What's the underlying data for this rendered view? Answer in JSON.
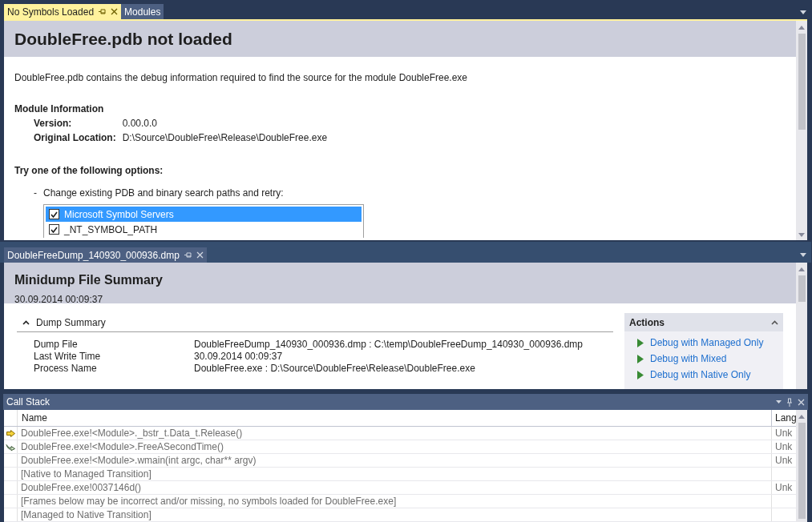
{
  "symbols_pane": {
    "tabs": [
      {
        "label": "No Symbols Loaded",
        "selected": true,
        "pinnable": true
      },
      {
        "label": "Modules",
        "selected": false,
        "pinnable": false
      }
    ],
    "title": "DoubleFree.pdb not loaded",
    "description": "DoubleFree.pdb contains the debug information required to find the source for the module DoubleFree.exe",
    "module_heading": "Module Information",
    "module_info": [
      {
        "label": "Version:",
        "value": "0.00.0.0"
      },
      {
        "label": "Original Location:",
        "value": "D:\\Source\\DoubleFree\\Release\\DoubleFree.exe"
      }
    ],
    "options_heading": "Try one of the following options:",
    "option_bullet": "-",
    "option_text": "Change existing PDB and binary search paths and retry:",
    "search_paths": [
      {
        "label": "Microsoft Symbol Servers",
        "checked": true,
        "selected": true
      },
      {
        "label": "_NT_SYMBOL_PATH",
        "checked": true,
        "selected": false
      }
    ]
  },
  "dump_pane": {
    "tabs": [
      {
        "label": "DoubleFreeDump_140930_000936.dmp",
        "selected": false,
        "pinnable": true
      }
    ],
    "title": "Minidump File Summary",
    "timestamp": "30.09.2014 00:09:37",
    "section": {
      "label": "Dump Summary",
      "expanded": true
    },
    "rows": [
      {
        "label": "Dump File",
        "value": "DoubleFreeDump_140930_000936.dmp : C:\\temp\\DoubleFreeDump_140930_000936.dmp"
      },
      {
        "label": "Last Write Time",
        "value": "30.09.2014 00:09:37"
      },
      {
        "label": "Process Name",
        "value": "DoubleFree.exe : D:\\Source\\DoubleFree\\Release\\DoubleFree.exe"
      }
    ],
    "actions": {
      "title": "Actions",
      "expanded": true,
      "items": [
        "Debug with Managed Only",
        "Debug with Mixed",
        "Debug with Native Only"
      ]
    }
  },
  "call_stack": {
    "title": "Call Stack",
    "columns": [
      "Name",
      "Lang"
    ],
    "rows": [
      {
        "kind": "current",
        "name": "DoubleFree.exe!<Module>._bstr_t.Data_t.Release()",
        "lang": "Unk"
      },
      {
        "kind": "return",
        "name": "DoubleFree.exe!<Module>.FreeASecondTime()",
        "lang": "Unk"
      },
      {
        "kind": "plain",
        "name": "DoubleFree.exe!<Module>.wmain(int argc, char** argv)",
        "lang": "Unk"
      },
      {
        "kind": "plain",
        "name": "[Native to Managed Transition]"
      },
      {
        "kind": "plain",
        "name": "DoubleFree.exe!0037146d()",
        "lang": "Unk"
      },
      {
        "kind": "plain",
        "name": "[Frames below may be incorrect and/or missing, no symbols loaded for DoubleFree.exe]"
      },
      {
        "kind": "plain",
        "name": "[Managed to Native Transition]"
      }
    ]
  }
}
